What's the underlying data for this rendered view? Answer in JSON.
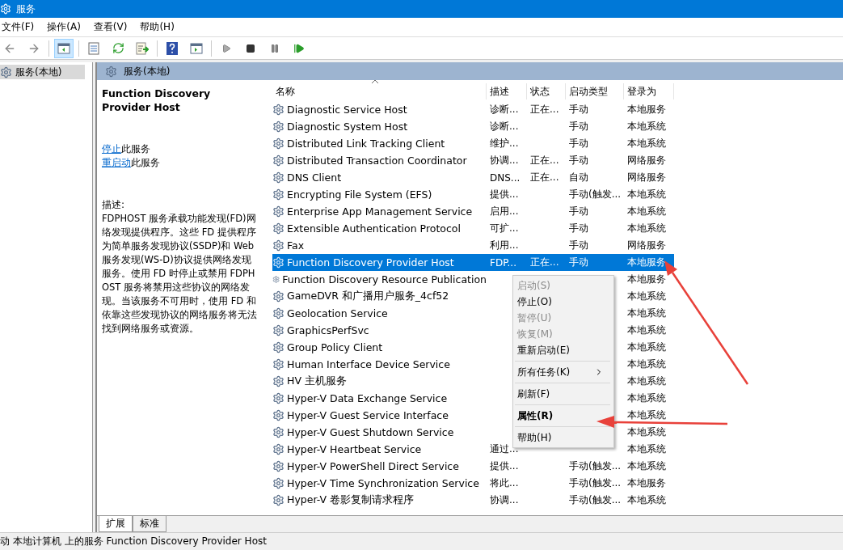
{
  "window": {
    "title": "服务"
  },
  "menu_bar": [
    "文件(F)",
    "操作(A)",
    "查看(V)",
    "帮助(H)"
  ],
  "tree": {
    "items": [
      {
        "label": "服务(本地)",
        "selected": true
      }
    ]
  },
  "panel": {
    "title": "服务(本地)"
  },
  "details": {
    "service_name": "Function Discovery Provider Host",
    "actions": [
      {
        "link": "停止",
        "text": "此服务"
      },
      {
        "link": "重启动",
        "text": "此服务"
      }
    ],
    "description_label": "描述:",
    "description": "FDPHOST 服务承载功能发现(FD)网络发现提供程序。这些 FD 提供程序为简单服务发现协议(SSDP)和 Web 服务发现(WS-D)协议提供网络发现服务。使用 FD 时停止或禁用 FDPHOST 服务将禁用这些协议的网络发现。当该服务不可用时，使用 FD 和依靠这些发现协议的网络服务将无法找到网络服务或资源。"
  },
  "table": {
    "columns": [
      {
        "label": "名称",
        "sorted": true
      },
      {
        "label": "描述",
        "sorted": false
      },
      {
        "label": "状态",
        "sorted": false
      },
      {
        "label": "启动类型",
        "sorted": false
      },
      {
        "label": "登录为",
        "sorted": false
      }
    ],
    "rows": [
      {
        "name": "Diagnostic Service Host",
        "description": "诊断...",
        "status": "正在...",
        "startup": "手动",
        "logon": "本地服务",
        "selected": false
      },
      {
        "name": "Diagnostic System Host",
        "description": "诊断...",
        "startup": "手动",
        "logon": "本地系统",
        "selected": false
      },
      {
        "name": "Distributed Link Tracking Client",
        "description": "维护...",
        "startup": "手动",
        "logon": "本地系统",
        "selected": false
      },
      {
        "name": "Distributed Transaction Coordinator",
        "description": "协调...",
        "status": "正在...",
        "startup": "手动",
        "logon": "网络服务",
        "selected": false
      },
      {
        "name": "DNS Client",
        "description": "DNS...",
        "status": "正在...",
        "startup": "自动",
        "logon": "网络服务",
        "selected": false
      },
      {
        "name": "Encrypting File System (EFS)",
        "description": "提供...",
        "startup": "手动(触发...",
        "logon": "本地系统",
        "selected": false
      },
      {
        "name": "Enterprise App Management Service",
        "description": "启用...",
        "startup": "手动",
        "logon": "本地系统",
        "selected": false
      },
      {
        "name": "Extensible Authentication Protocol",
        "description": "可扩...",
        "startup": "手动",
        "logon": "本地系统",
        "selected": false
      },
      {
        "name": "Fax",
        "description": "利用...",
        "startup": "手动",
        "logon": "网络服务",
        "selected": false
      },
      {
        "name": "Function Discovery Provider Host",
        "description": "FDP...",
        "status": "正在...",
        "startup": "手动",
        "logon": "本地服务",
        "selected": true
      },
      {
        "name": "Function Discovery Resource Publication",
        "logon": "本地服务",
        "selected": false
      },
      {
        "name": "GameDVR 和广播用户服务_4cf52",
        "logon": "本地系统",
        "selected": false
      },
      {
        "name": "Geolocation Service",
        "logon": "本地系统",
        "selected": false
      },
      {
        "name": "GraphicsPerfSvc",
        "logon": "本地系统",
        "selected": false
      },
      {
        "name": "Group Policy Client",
        "logon": "本地系统",
        "selected": false
      },
      {
        "name": "Human Interface Device Service",
        "logon": "本地系统",
        "selected": false
      },
      {
        "name": "HV 主机服务",
        "logon": "本地系统",
        "selected": false
      },
      {
        "name": "Hyper-V Data Exchange Service",
        "logon": "本地系统",
        "selected": false
      },
      {
        "name": "Hyper-V Guest Service Interface",
        "logon": "本地系统",
        "selected": false
      },
      {
        "name": "Hyper-V Guest Shutdown Service",
        "logon": "本地系统",
        "selected": false
      },
      {
        "name": "Hyper-V Heartbeat Service",
        "description": "通过...",
        "logon": "本地系统",
        "selected": false
      },
      {
        "name": "Hyper-V PowerShell Direct Service",
        "description": "提供...",
        "startup": "手动(触发...",
        "logon": "本地系统",
        "selected": false
      },
      {
        "name": "Hyper-V Time Synchronization Service",
        "description": "将此...",
        "startup": "手动(触发...",
        "logon": "本地服务",
        "selected": false
      },
      {
        "name": "Hyper-V 卷影复制请求程序",
        "description": "协调...",
        "startup": "手动(触发...",
        "logon": "本地系统",
        "selected": false
      }
    ]
  },
  "context_menu": {
    "items": [
      {
        "kind": "item",
        "label": "启动(S)",
        "disabled": true,
        "bold": false
      },
      {
        "kind": "item",
        "label": "停止(O)",
        "disabled": false,
        "bold": false
      },
      {
        "kind": "item",
        "label": "暂停(U)",
        "disabled": true,
        "bold": false
      },
      {
        "kind": "item",
        "label": "恢复(M)",
        "disabled": true,
        "bold": false
      },
      {
        "kind": "item",
        "label": "重新启动(E)",
        "disabled": false,
        "bold": false
      },
      {
        "kind": "separator"
      },
      {
        "kind": "submenu",
        "label": "所有任务(K)",
        "disabled": false,
        "bold": false
      },
      {
        "kind": "separator"
      },
      {
        "kind": "item",
        "label": "刷新(F)",
        "disabled": false,
        "bold": false
      },
      {
        "kind": "separator"
      },
      {
        "kind": "item",
        "label": "属性(R)",
        "disabled": false,
        "bold": true
      },
      {
        "kind": "separator"
      },
      {
        "kind": "item",
        "label": "帮助(H)",
        "disabled": false,
        "bold": false
      }
    ]
  },
  "view_tabs": [
    {
      "label": "扩展",
      "selected": true
    },
    {
      "label": "标准",
      "selected": false
    }
  ],
  "status_bar": "动 本地计算机 上的服务 Function Discovery Provider Host"
}
